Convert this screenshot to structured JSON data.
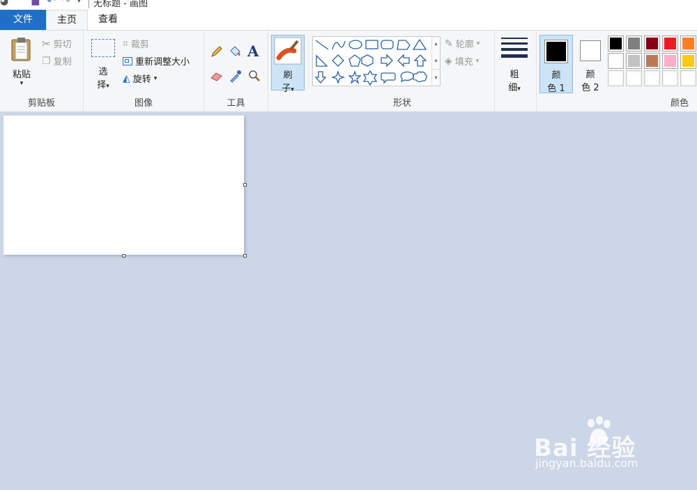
{
  "window": {
    "title": "无标题 - 画图"
  },
  "tabs": [
    {
      "label": "文件"
    },
    {
      "label": "主页"
    },
    {
      "label": "查看"
    }
  ],
  "clipboard": {
    "paste": "粘贴",
    "cut": "剪切",
    "copy": "复制",
    "group_label": "剪贴板"
  },
  "image": {
    "select_top": "选",
    "select_bottom": "择",
    "crop": "裁剪",
    "resize": "重新调整大小",
    "rotate": "旋转",
    "group_label": "图像"
  },
  "tools": {
    "group_label": "工具"
  },
  "brush": {
    "top": "刷",
    "bottom": "子"
  },
  "shapes": {
    "outline": "轮廓",
    "fill": "填充",
    "group_label": "形状"
  },
  "size": {
    "top": "粗",
    "bottom": "细"
  },
  "colors": {
    "color1_top": "颜",
    "color1_bottom": "色 1",
    "color2_top": "颜",
    "color2_bottom": "色 2",
    "group_label": "颜色",
    "color1_value": "#000000",
    "color2_value": "#ffffff",
    "palette": [
      "#000000",
      "#7f7f7f",
      "#880015",
      "#ed1c24",
      "#ff7f27",
      "#ffffff",
      "#c3c3c3",
      "#b97a57",
      "#ffaec9",
      "#ffc90e",
      "#ffffff",
      "#ffffff",
      "#ffffff",
      "#ffffff",
      "#ffffff"
    ]
  },
  "watermark": {
    "brand": "Bai  经验",
    "url": "jingyan.baidu.com"
  }
}
